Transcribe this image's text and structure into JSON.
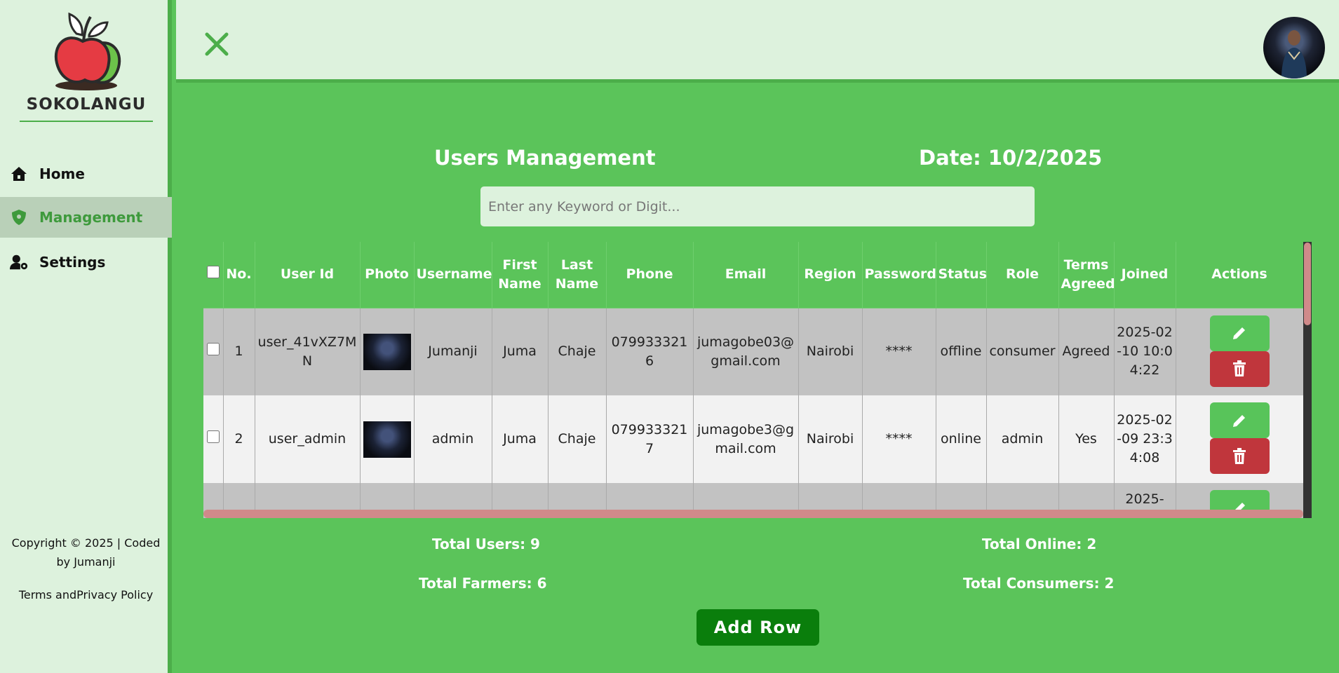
{
  "sidebar": {
    "logo_text": "SOKOLANGU",
    "items": [
      {
        "label": "Home",
        "icon": "home-icon"
      },
      {
        "label": "Management",
        "icon": "shield-icon"
      },
      {
        "label": "Settings",
        "icon": "user-gear-icon"
      }
    ],
    "copyright_line1": "Copyright © 2025 | Coded",
    "copyright_line2": "by Jumanji",
    "terms": "Terms andPrivacy Policy"
  },
  "header": {
    "close_icon": "close-icon"
  },
  "main": {
    "title": "Users Management",
    "date": "Date: 10/2/2025",
    "search_placeholder": "Enter any Keyword or Digit..."
  },
  "table": {
    "headers": [
      "No.",
      "User Id",
      "Photo",
      "Username",
      "First Name",
      "Last Name",
      "Phone",
      "Email",
      "Region",
      "Password",
      "Status",
      "Role",
      "Terms Agreed",
      "Joined",
      "Actions"
    ],
    "rows": [
      {
        "no": "1",
        "user_id": "user_41vXZ7MN",
        "username": "Jumanji",
        "first_name": "Juma",
        "last_name": "Chaje",
        "phone": "0799333216",
        "email": "jumagobe03@gmail.com",
        "region": "Nairobi",
        "password": "****",
        "status": "offline",
        "role": "consumer",
        "terms": "Agreed",
        "joined": "2025-02-10 10:04:22"
      },
      {
        "no": "2",
        "user_id": "user_admin",
        "username": "admin",
        "first_name": "Juma",
        "last_name": "Chaje",
        "phone": "0799333217",
        "email": "jumagobe3@gmail.com",
        "region": "Nairobi",
        "password": "****",
        "status": "online",
        "role": "admin",
        "terms": "Yes",
        "joined": "2025-02-09 23:34:08"
      },
      {
        "no": "",
        "user_id": "",
        "username": "",
        "first_name": "",
        "last_name": "",
        "phone": "",
        "email": "",
        "region": "",
        "password": "",
        "status": "",
        "role": "",
        "terms": "",
        "joined": "2025-"
      }
    ]
  },
  "stats": {
    "total_users": "Total Users: 9",
    "total_online": "Total Online: 2",
    "total_farmers": "Total Farmers: 6",
    "total_consumers": "Total Consumers: 2"
  },
  "add_row_label": "Add Row",
  "colors": {
    "primary_green": "#5bc45a",
    "light_green": "#ddf2dd",
    "dark_green": "#0a7e0c",
    "delete_red": "#c0363c"
  }
}
